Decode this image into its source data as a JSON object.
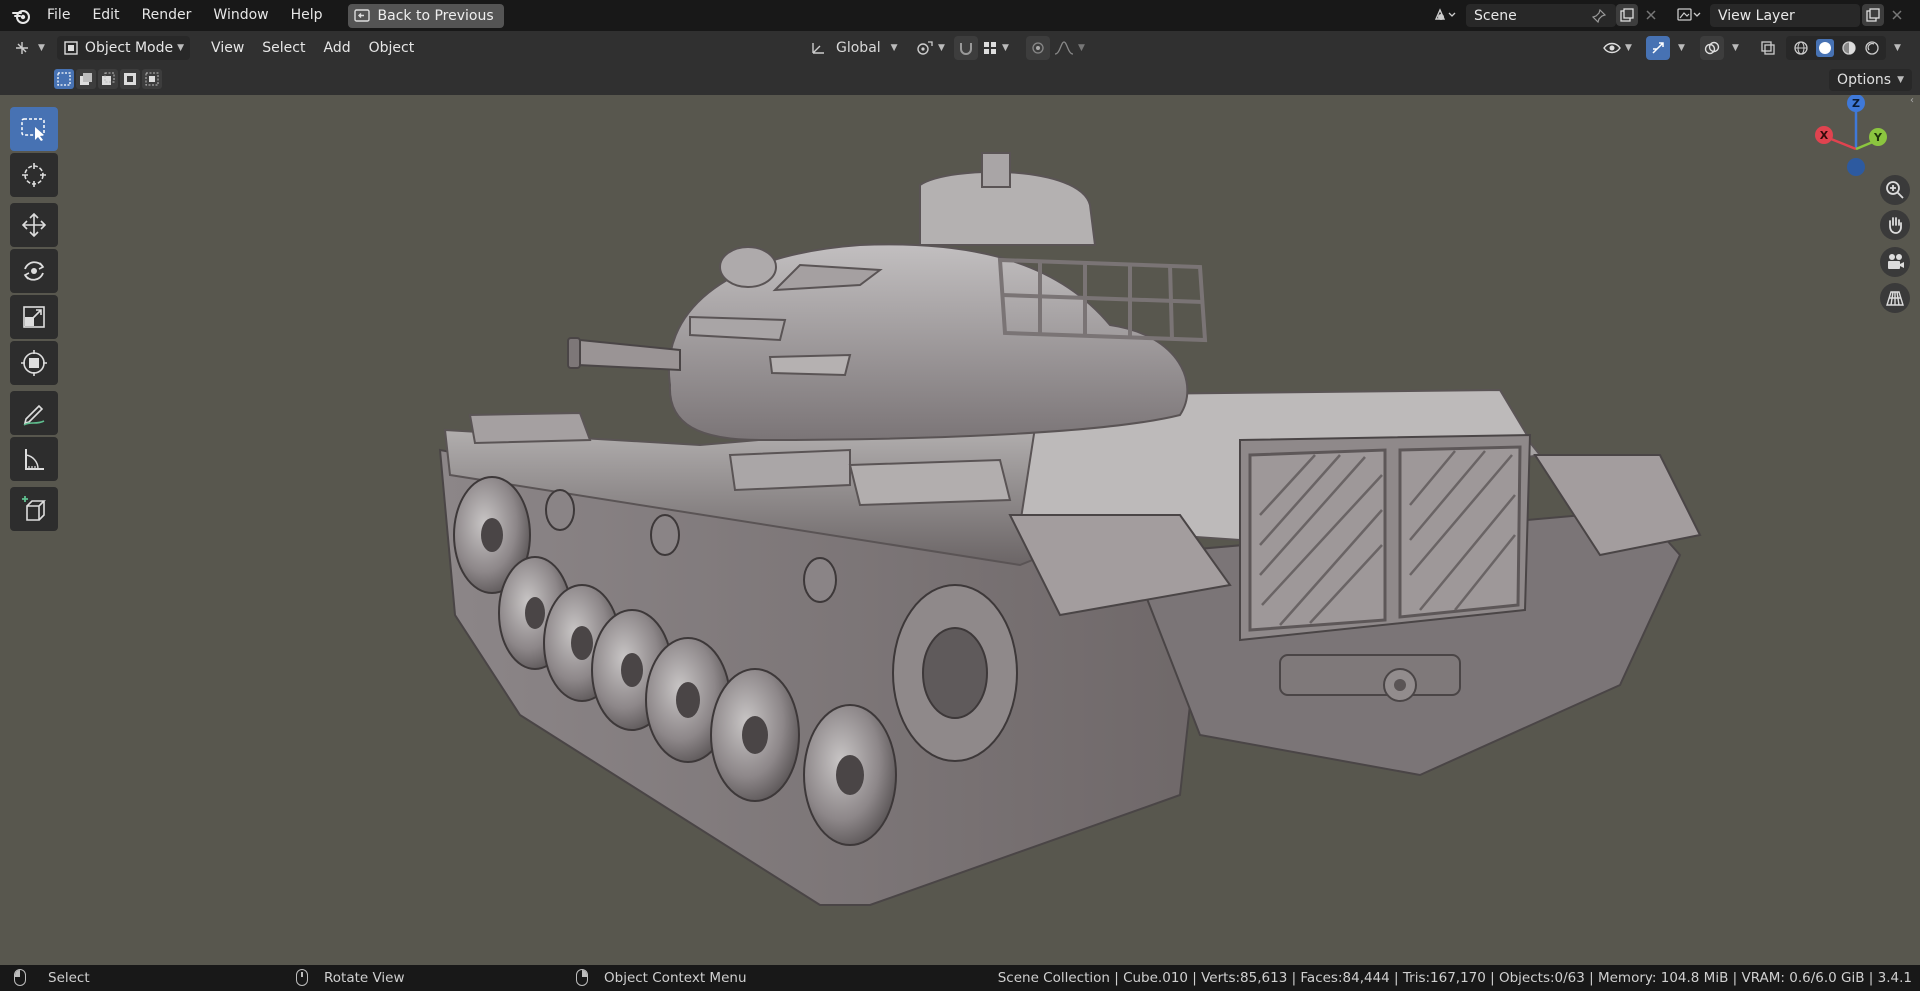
{
  "topbar": {
    "menus": [
      "File",
      "Edit",
      "Render",
      "Window",
      "Help"
    ],
    "back_button": "Back to Previous",
    "scene": "Scene",
    "view_layer": "View Layer"
  },
  "viewport_header": {
    "mode": "Object Mode",
    "menus": [
      "View",
      "Select",
      "Add",
      "Object"
    ],
    "transform_orientation": "Global"
  },
  "tool_settings": {
    "options_label": "Options"
  },
  "toolbar": {
    "tools": [
      "select-box",
      "cursor",
      "move",
      "rotate",
      "scale",
      "transform",
      "annotate",
      "measure",
      "add-cube"
    ],
    "active": "select-box"
  },
  "gizmo": {
    "x": "X",
    "y": "Y",
    "z": "Z"
  },
  "statusbar": {
    "left_action": "Select",
    "middle_action": "Rotate View",
    "right_action": "Object Context Menu",
    "stats": "Scene Collection | Cube.010 | Verts:85,613 | Faces:84,444 | Tris:167,170 | Objects:0/63 | Memory: 104.8 MiB | VRAM: 0.6/6.0 GiB | 3.4.1"
  },
  "colors": {
    "viewport_bg": "#58574e",
    "accent": "#4772b3",
    "axis_x": "#e0434f",
    "axis_y": "#8bc53f",
    "axis_z": "#3f79d9"
  }
}
